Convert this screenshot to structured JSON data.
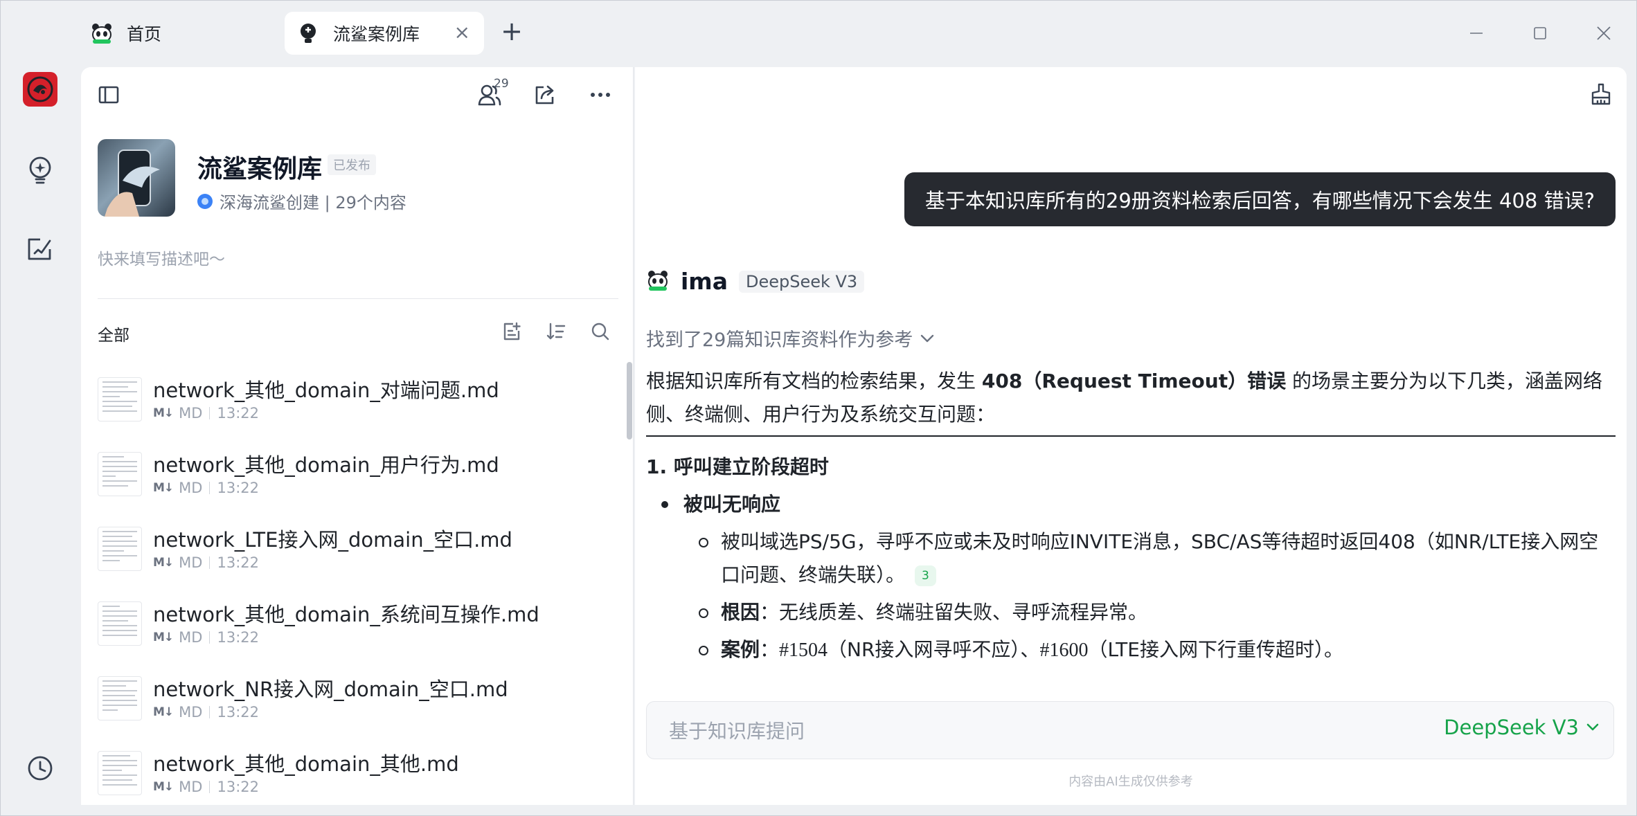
{
  "tabs": [
    {
      "label": "首页",
      "icon": "panda-icon"
    },
    {
      "label": "流鲨案例库",
      "icon": "lightbulb-icon"
    }
  ],
  "rail": {
    "logo_icon": "app-logo-icon",
    "items": [
      "lightbulb-icon",
      "edit-note-icon",
      "history-icon"
    ]
  },
  "kb": {
    "title": "流鲨案例库",
    "status_badge": "已发布",
    "meta": "深海流鲨创建 | 29个内容",
    "description_placeholder": "快来填写描述吧～",
    "member_count": "29",
    "filter_label": "全部"
  },
  "files": [
    {
      "name": "network_其他_domain_对端问题.md",
      "type": "MD",
      "time": "13:22"
    },
    {
      "name": "network_其他_domain_用户行为.md",
      "type": "MD",
      "time": "13:22"
    },
    {
      "name": "network_LTE接入网_domain_空口.md",
      "type": "MD",
      "time": "13:22"
    },
    {
      "name": "network_其他_domain_系统间互操作.md",
      "type": "MD",
      "time": "13:22"
    },
    {
      "name": "network_NR接入网_domain_空口.md",
      "type": "MD",
      "time": "13:22"
    },
    {
      "name": "network_其他_domain_其他.md",
      "type": "MD",
      "time": "13:22"
    }
  ],
  "chat": {
    "user_question": "基于本知识库所有的29册资料检索后回答，有哪些情况下会发生 408 错误?",
    "ai_name": "ima",
    "ai_model": "DeepSeek V3",
    "references": "找到了29篇知识库资料作为参考",
    "intro_a": "根据知识库所有文档的检索结果，发生 ",
    "intro_bold": "408（Request Timeout）错误",
    "intro_b": " 的场景主要分为以下几类，涵盖网络侧、终端侧、用户行为及系统交互问题：",
    "section1_title": "1. 呼叫建立阶段超时",
    "bullet1": "被叫无响应",
    "sub1": "被叫域选PS/5G，寻呼不应或未及时响应INVITE消息，SBC/AS等待超时返回408（如NR/LTE接入网空口问题、终端失联）。",
    "sub1_cite": "3",
    "sub2_label": "根因",
    "sub2_text": "：无线质差、终端驻留失败、寻呼流程异常。",
    "sub3_label": "案例",
    "sub3_text_a": "：",
    "sub3_case1": "#1504",
    "sub3_text_b": "（NR接入网寻呼不应）、",
    "sub3_case2": "#1600",
    "sub3_text_c": "（LTE接入网下行重传超时）。"
  },
  "input": {
    "placeholder": "基于知识库提问",
    "model": "DeepSeek V3"
  },
  "disclaimer": "内容由AI生成仅供参考",
  "colors": {
    "accent_green": "#16a34a",
    "bubble_dark": "#272a30",
    "logo_red": "#d4202a"
  }
}
